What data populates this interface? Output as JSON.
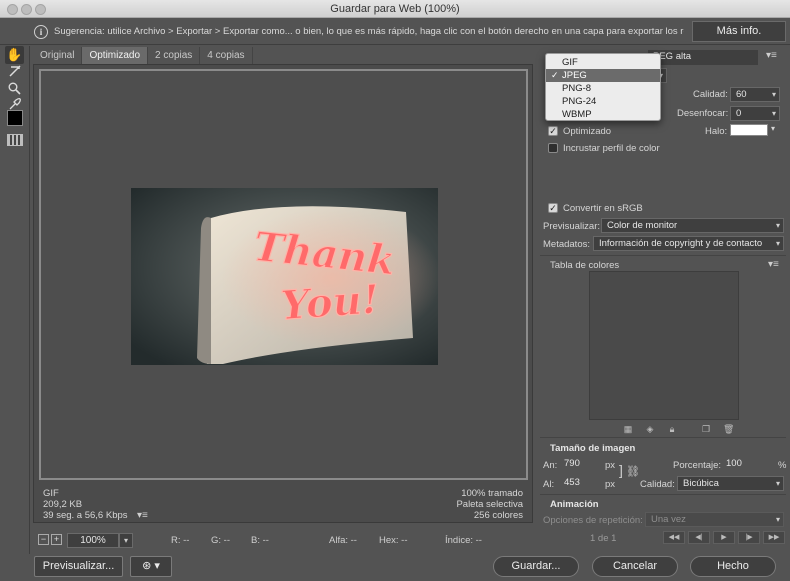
{
  "window": {
    "title": "Guardar para Web (100%)"
  },
  "hint": {
    "text": "Sugerencia: utilice Archivo > Exportar > Exportar como... o bien, lo que es más rápido, haga clic con el botón derecho en una capa para exportar los recursos",
    "more_button": "Más info."
  },
  "toolbar": {
    "tools": [
      "hand-tool",
      "slice-select-tool",
      "zoom-tool",
      "eyedropper-tool"
    ]
  },
  "tabs": [
    "Original",
    "Optimizado",
    "2 copias",
    "4 copias"
  ],
  "preview": {
    "image_text": [
      "Thank",
      "You!"
    ],
    "left_stats": [
      "GIF",
      "209,2 KB",
      "39 seg. a 56,6 Kbps"
    ],
    "right_stats": [
      "100% tramado",
      "Paleta selectiva",
      "256 colores"
    ]
  },
  "status_bar": {
    "zoom": "100%",
    "r": "R: --",
    "g": "G: --",
    "b": "B: --",
    "alpha": "Alfa: --",
    "hex": "Hex: --",
    "index": "Índice: --"
  },
  "footer": {
    "preview_button": "Previsualizar...",
    "save_button": "Guardar...",
    "cancel_button": "Cancelar",
    "done_button": "Hecho"
  },
  "settings": {
    "preset_value": "PEG alta",
    "format_options": [
      "GIF",
      "JPEG",
      "PNG-8",
      "PNG-24",
      "WBMP"
    ],
    "format_selected_index": 1,
    "quality_label": "Calidad:",
    "quality_value": "60",
    "blur_label": "Desenfocar:",
    "blur_value": "0",
    "matte_label": "Halo:",
    "optimized_label": "Optimizado",
    "optimized_checked": true,
    "embed_profile_label": "Incrustar perfil de color",
    "embed_profile_checked": false,
    "convert_srgb_label": "Convertir en sRGB",
    "convert_srgb_checked": true,
    "preview_label": "Previsualizar:",
    "preview_value": "Color de monitor",
    "metadata_label": "Metadatos:",
    "metadata_value": "Información de copyright y de contacto",
    "color_table_label": "Tabla de colores"
  },
  "image_size": {
    "title": "Tamaño de imagen",
    "width_label": "An:",
    "width_value": "790",
    "height_label": "Al:",
    "height_value": "453",
    "unit": "px",
    "percent_label": "Porcentaje:",
    "percent_value": "100",
    "percent_unit": "%",
    "quality_label": "Calidad:",
    "quality_value": "Bicúbica"
  },
  "animation": {
    "title": "Animación",
    "loop_label": "Opciones de repetición:",
    "loop_value": "Una vez",
    "frame_counter": "1 de 1"
  },
  "colors": {
    "background": "#535353",
    "selected_menu": "#6b6b6b",
    "neon": "#ff6a6a"
  }
}
